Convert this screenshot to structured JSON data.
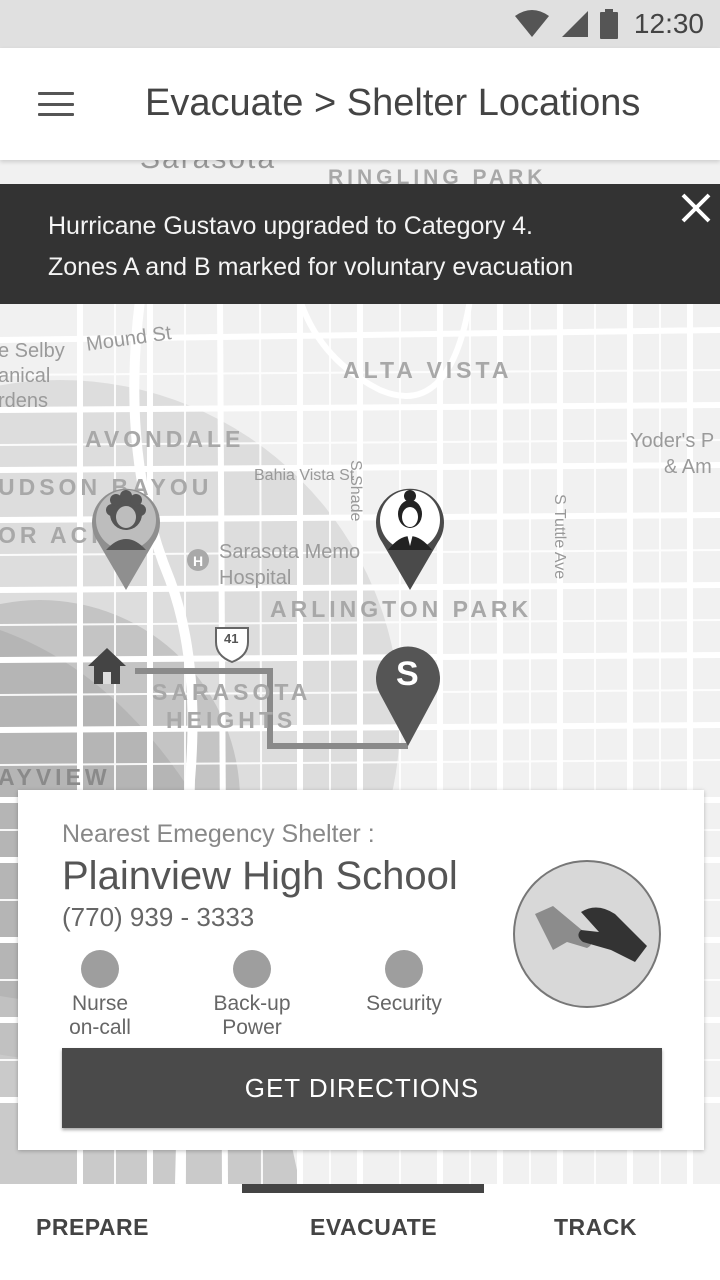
{
  "status_bar": {
    "time": "12:30"
  },
  "app_bar": {
    "title": "Evacuate > Shelter Locations"
  },
  "alert": {
    "line1": "Hurricane Gustavo upgraded to Category 4.",
    "line2": "Zones A and B marked for voluntary evacuation"
  },
  "map": {
    "labels": {
      "sarasota": "Sarasota",
      "ringling_park": "RINGLING PARK",
      "mound_st": "Mound St",
      "selby": "e Selby",
      "anical": "anical",
      "rdens": "rdens",
      "alta_vista": "ALTA VISTA",
      "avondale": "AVONDALE",
      "hudson_bayou": "UDSON BAYOU",
      "or_ach": "OR ACH",
      "bahia_vista": "Bahia Vista St",
      "s_shade": "S Shade",
      "s_tuttle": "S Tuttle Ave",
      "yoders1": "Yoder's P",
      "yoders2": "& Am",
      "hospital1": "Sarasota Memo",
      "hospital2": "Hospital",
      "arlington_park": "ARLINGTON PARK",
      "route_41": "41",
      "sarasota_heights1": "SARASOTA",
      "sarasota_heights2": "HEIGHTS",
      "bayview": "AYVIEW"
    },
    "shelter_marker_letter": "S"
  },
  "shelter_card": {
    "subtitle": "Nearest Emegency Shelter :",
    "name": "Plainview High School",
    "phone": "(770) 939 - 3333",
    "amenities": [
      {
        "label": "Nurse\non-call"
      },
      {
        "label": "Back-up\nPower"
      },
      {
        "label": "Security"
      }
    ],
    "button_label": "GET DIRECTIONS"
  },
  "bottom_nav": {
    "items": [
      "PREPARE",
      "EVACUATE",
      "TRACK"
    ],
    "active": "EVACUATE"
  },
  "colors": {
    "alert_bg": "#333333",
    "button_bg": "#4a4a4a",
    "marker": "#555555"
  }
}
